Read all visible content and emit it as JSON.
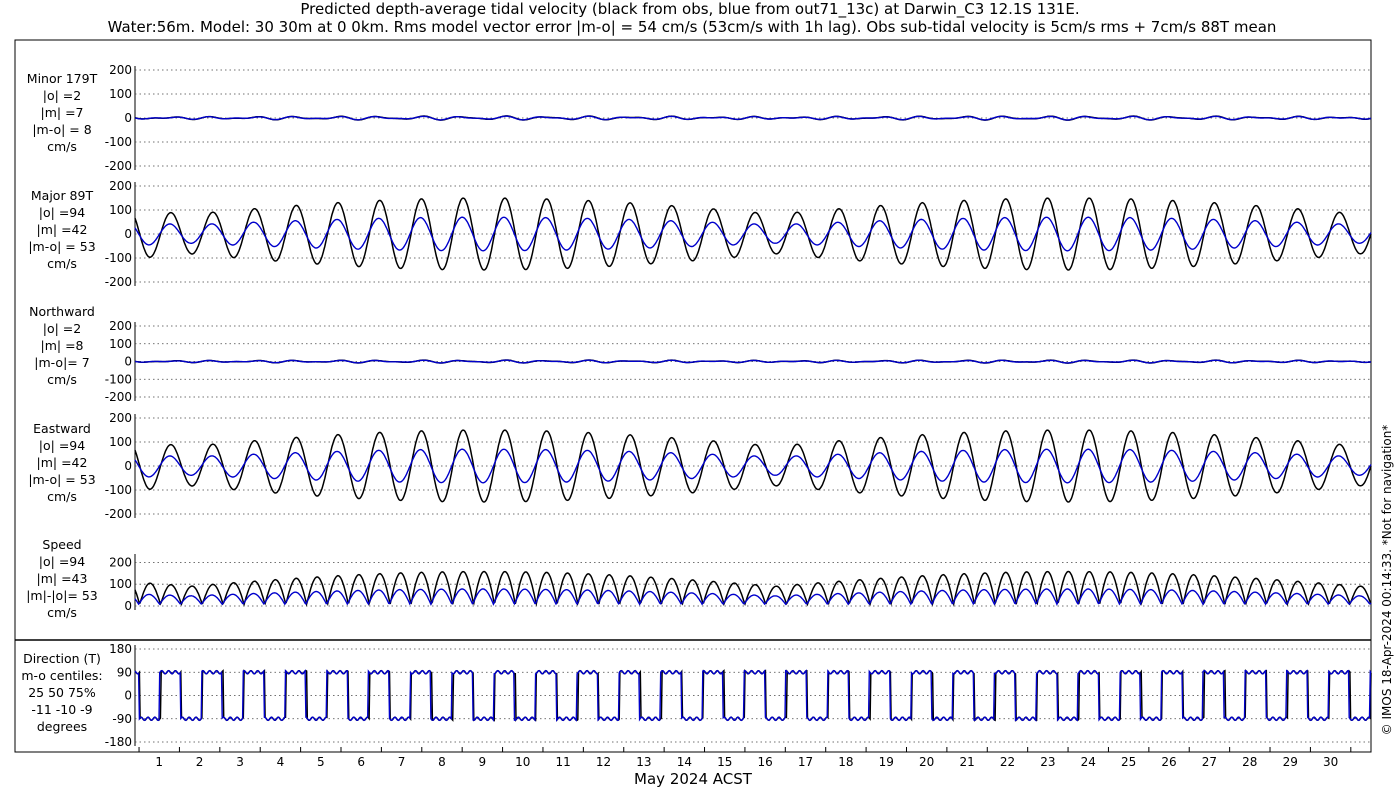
{
  "title": {
    "line1": "Predicted depth-average tidal velocity (black from obs, blue from out71_13c) at Darwin_C3 12.1S 131E.",
    "line2": "Water:56m. Model: 30 30m at 0 0km. Rms model vector error |m-o| = 54 cm/s (53cm/s with 1h lag). Obs sub-tidal velocity is 5cm/s rms + 7cm/s 88T mean"
  },
  "watermark": "© IMOS 18-Apr-2024 00:14:33. *Not for navigation*",
  "colors": {
    "obs": "#000000",
    "model": "#0000cc",
    "axis": "#000000"
  },
  "chart_data": {
    "type": "line",
    "xlabel": "May 2024 ACST",
    "x_ticks": [
      "1",
      "2",
      "3",
      "4",
      "5",
      "6",
      "7",
      "8",
      "9",
      "10",
      "11",
      "12",
      "13",
      "14",
      "15",
      "16",
      "17",
      "18",
      "19",
      "20",
      "21",
      "22",
      "23",
      "24",
      "25",
      "26",
      "27",
      "28",
      "29",
      "30"
    ],
    "xlim_days": [
      0.4,
      31.0
    ],
    "series_legend": {
      "obs": "black from obs",
      "model": "blue from out71_13c"
    },
    "panels": [
      {
        "id": "minor",
        "label_lines": [
          "Minor 179T",
          "|o| =2",
          "|m| =7",
          "|m-o| = 8",
          "cm/s"
        ],
        "yticks": [
          "200",
          "100",
          "0",
          "-100",
          "-200"
        ],
        "ylim": [
          -200,
          200
        ],
        "obs_amplitude": 6,
        "model_amplitude": 5
      },
      {
        "id": "major",
        "label_lines": [
          "Major 89T",
          "|o| =94",
          "|m| =42",
          "|m-o| = 53",
          "cm/s"
        ],
        "yticks": [
          "200",
          "100",
          "0",
          "-100",
          "-200"
        ],
        "ylim": [
          -200,
          200
        ],
        "obs_amplitude": 150,
        "model_amplitude": 70
      },
      {
        "id": "north",
        "label_lines": [
          "Northward",
          "|o| =2",
          "|m| =8",
          "|m-o|= 7",
          "cm/s"
        ],
        "yticks": [
          "200",
          "100",
          "0",
          "-100",
          "-200"
        ],
        "ylim": [
          -200,
          200
        ],
        "obs_amplitude": 6,
        "model_amplitude": 5
      },
      {
        "id": "east",
        "label_lines": [
          "Eastward",
          "|o| =94",
          "|m| =42",
          "|m-o| = 53",
          "cm/s"
        ],
        "yticks": [
          "200",
          "100",
          "0",
          "-100",
          "-200"
        ],
        "ylim": [
          -200,
          200
        ],
        "obs_amplitude": 150,
        "model_amplitude": 70
      },
      {
        "id": "speed",
        "label_lines": [
          "Speed",
          "|o| =94",
          "|m| =43",
          "|m|-|o|= 53",
          "cm/s"
        ],
        "yticks": [
          "200",
          "100",
          "0"
        ],
        "ylim": [
          0,
          220
        ],
        "obs_amplitude": 150,
        "model_amplitude": 70
      },
      {
        "id": "direction",
        "label_lines": [
          "Direction (T)",
          "m-o centiles:",
          "25  50  75%",
          "-11  -10   -9",
          "degrees"
        ],
        "yticks": [
          "180",
          "90",
          "0",
          "-90",
          "-180"
        ],
        "ylim": [
          -180,
          180
        ],
        "obs_amplitude": 90,
        "model_amplitude": 90
      }
    ]
  }
}
